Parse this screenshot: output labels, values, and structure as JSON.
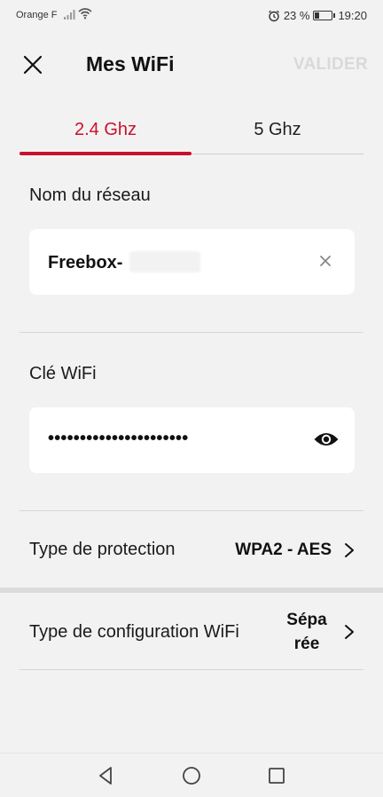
{
  "status_bar": {
    "carrier": "Orange F",
    "battery": "23 %",
    "time": "19:20"
  },
  "header": {
    "title": "Mes WiFi",
    "validate_label": "VALIDER",
    "close_icon": "close-icon"
  },
  "tabs": [
    {
      "label": "2.4 Ghz",
      "active": true
    },
    {
      "label": "5 Ghz",
      "active": false
    }
  ],
  "network_name": {
    "label": "Nom du réseau",
    "value": "Freebox-"
  },
  "wifi_key": {
    "label": "Clé WiFi",
    "value": "••••••••••••••••••••••"
  },
  "protection": {
    "label": "Type de protection",
    "value": "WPA2 - AES"
  },
  "configuration": {
    "label": "Type de configuration WiFi",
    "value_line1": "Sépa",
    "value_line2": "rée"
  },
  "colors": {
    "accent": "#c8102e",
    "background": "#f3f2f2",
    "disabled": "#d9d9d9"
  }
}
